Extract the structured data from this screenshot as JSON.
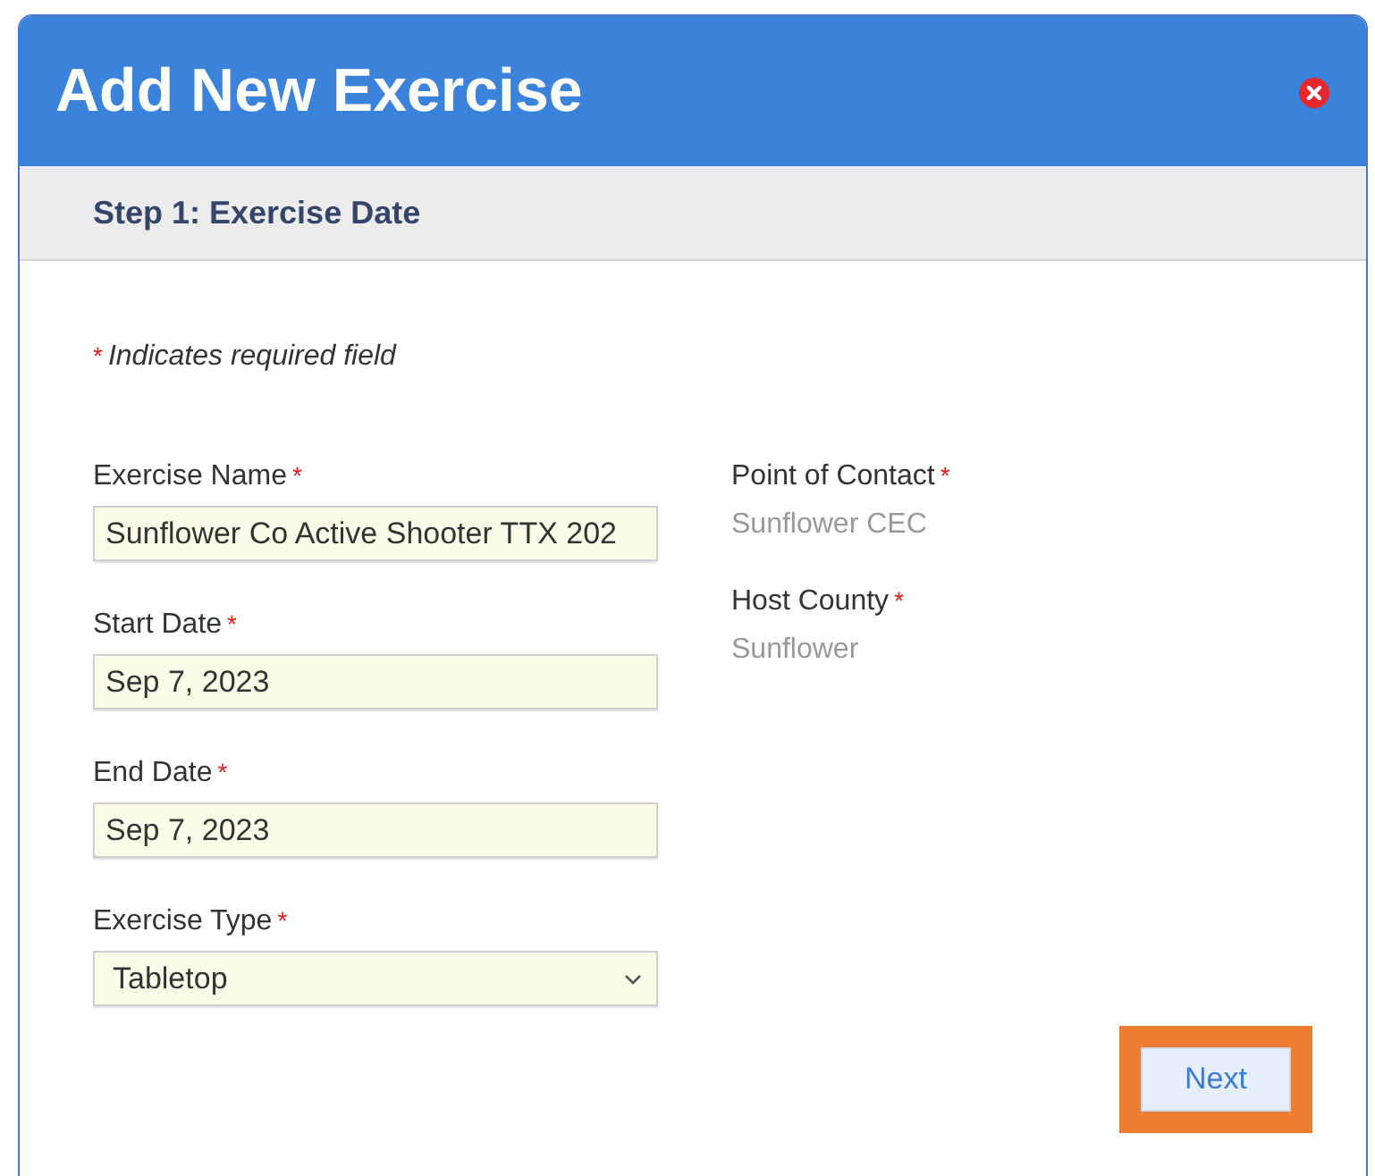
{
  "dialog": {
    "title": "Add New Exercise"
  },
  "step": {
    "title": "Step 1: Exercise Date"
  },
  "required_note": {
    "mark": "*",
    "text": "Indicates required field"
  },
  "fields": [
    {
      "label": "Exercise Name",
      "required_mark": "*",
      "kind": "text",
      "value": "Sunflower Co Active Shooter TTX 202"
    },
    {
      "label": "Start Date",
      "required_mark": "*",
      "kind": "text",
      "value": "Sep 7, 2023"
    },
    {
      "label": "End Date",
      "required_mark": "*",
      "kind": "text",
      "value": "Sep 7, 2023"
    },
    {
      "label": "Exercise Type",
      "required_mark": "*",
      "kind": "select",
      "value": "Tabletop"
    }
  ],
  "info": [
    {
      "label": "Point of Contact",
      "required_mark": "*",
      "value": "Sunflower CEC"
    },
    {
      "label": "Host County",
      "required_mark": "*",
      "value": "Sunflower"
    }
  ],
  "next_button": {
    "label": "Next",
    "highlighted": true
  }
}
